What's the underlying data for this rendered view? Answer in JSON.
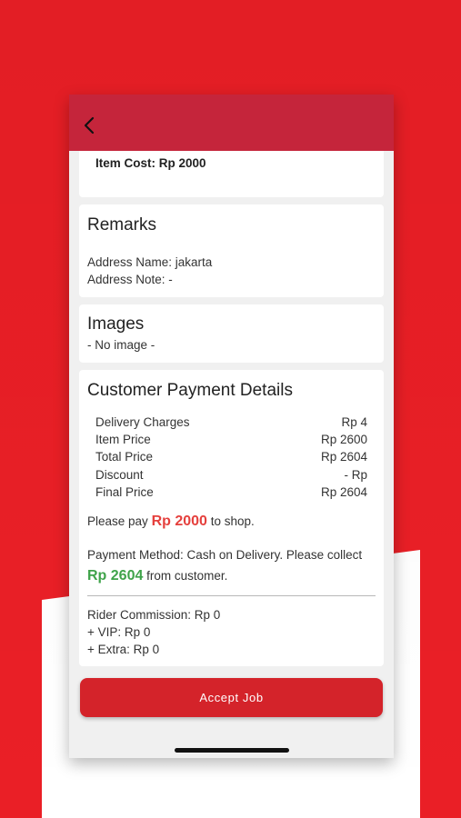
{
  "header": {
    "back_icon": "back-arrow-icon"
  },
  "item_cost": "Item Cost: Rp 2000",
  "remarks": {
    "title": "Remarks",
    "address_name": "Address Name: jakarta",
    "address_note": "Address Note: -"
  },
  "images": {
    "title": "Images",
    "value": "- No image -"
  },
  "payment": {
    "title": "Customer Payment Details",
    "rows": [
      {
        "label": "Delivery Charges",
        "value": "Rp 4"
      },
      {
        "label": "Item Price",
        "value": "Rp 2600"
      },
      {
        "label": "Total Price",
        "value": "Rp 2604"
      },
      {
        "label": "Discount",
        "value": "- Rp"
      },
      {
        "label": "Final Price",
        "value": "Rp 2604"
      }
    ],
    "pay_prefix": "Please pay",
    "pay_amount": "Rp 2000",
    "pay_suffix": "to shop.",
    "method_text": "Payment Method: Cash on Delivery. Please collect",
    "collect_amount": "Rp 2604",
    "collect_suffix": "from customer.",
    "rider_commission": "Rider Commission: Rp 0",
    "vip": "+ VIP: Rp 0",
    "extra": "+ Extra: Rp 0"
  },
  "accept_button": "Accept Job",
  "colors": {
    "brand_red": "#ea1f26",
    "appbar": "#c5253b",
    "button": "#d4232a",
    "pay_amount": "#e5403d",
    "collect_amount": "#3fa34a"
  }
}
